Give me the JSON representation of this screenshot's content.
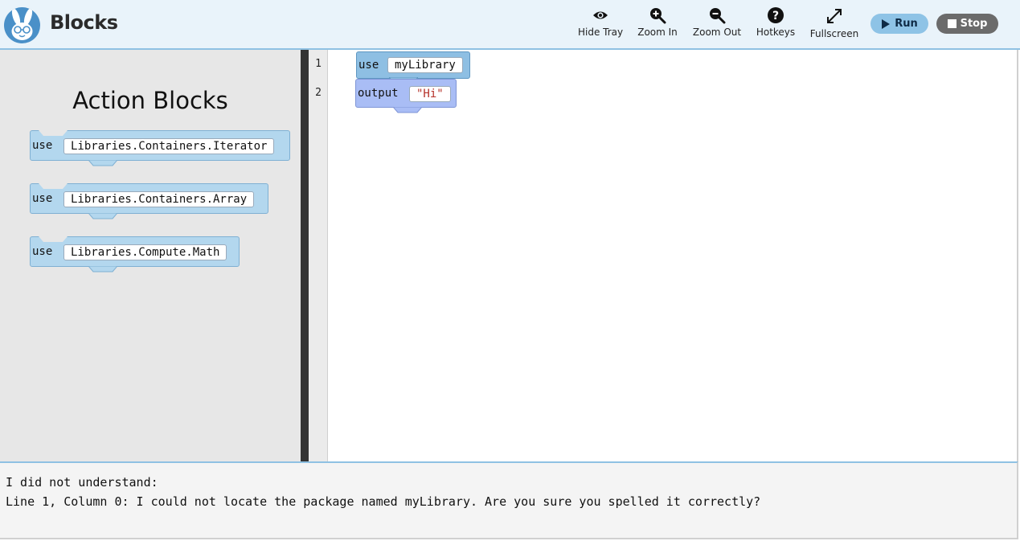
{
  "header": {
    "app_title": "Blocks",
    "logo_icon": "rabbit-logo-icon",
    "tools": [
      {
        "label": "Hide Tray",
        "icon": "eye-icon"
      },
      {
        "label": "Zoom In",
        "icon": "zoom-in-icon"
      },
      {
        "label": "Zoom Out",
        "icon": "zoom-out-icon"
      },
      {
        "label": "Hotkeys",
        "icon": "question-icon"
      },
      {
        "label": "Fullscreen",
        "icon": "expand-icon"
      }
    ],
    "run_label": "Run",
    "stop_label": "Stop"
  },
  "tray": {
    "title": "Action Blocks",
    "blocks": [
      {
        "keyword": "use",
        "value": "Libraries.Containers.Iterator"
      },
      {
        "keyword": "use",
        "value": "Libraries.Containers.Array"
      },
      {
        "keyword": "use",
        "value": "Libraries.Compute.Math"
      }
    ]
  },
  "editor": {
    "line_numbers": [
      "1",
      "2"
    ],
    "lines": [
      {
        "keyword": "use",
        "value": "myLibrary"
      },
      {
        "keyword": "output",
        "value": "\"Hi\""
      }
    ]
  },
  "output": {
    "line1": "I did not understand:",
    "line2": "Line 1, Column 0: I could not locate the package named myLibrary. Are you sure you spelled it correctly?"
  },
  "colors": {
    "header_bg": "#e9f3fa",
    "accent": "#8fc1e3",
    "tray_bg": "#e7e7e7",
    "block_use": "#b3d7ee",
    "block_output": "#a9bdf5",
    "string": "#b5322a",
    "run_button": "#8ec3e6",
    "stop_button": "#6b6b6b"
  }
}
